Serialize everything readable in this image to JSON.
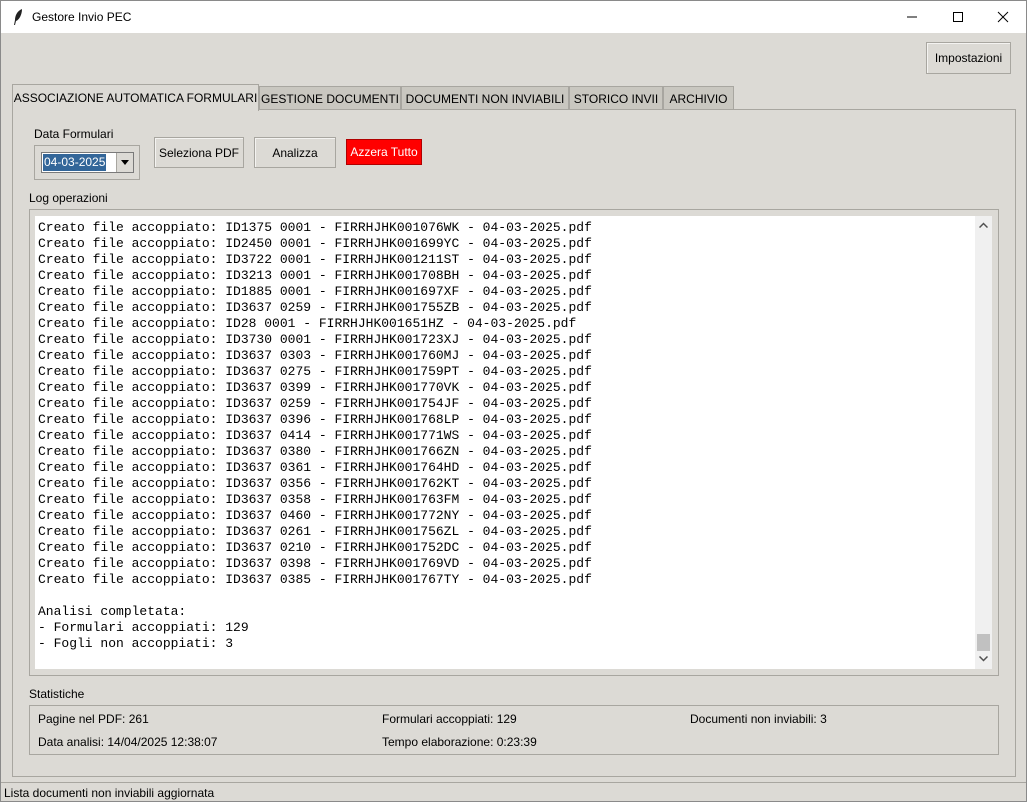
{
  "window": {
    "title": "Gestore Invio PEC",
    "app_icon": "feather-icon"
  },
  "toolbar": {
    "settings_label": "Impostazioni"
  },
  "tabs": [
    {
      "label": "ASSOCIAZIONE AUTOMATICA FORMULARI",
      "active": true
    },
    {
      "label": "GESTIONE DOCUMENTI",
      "active": false
    },
    {
      "label": "DOCUMENTI NON INVIABILI",
      "active": false
    },
    {
      "label": "STORICO INVII",
      "active": false
    },
    {
      "label": "ARCHIVIO",
      "active": false
    }
  ],
  "controls": {
    "date_label": "Data Formulari",
    "date_value": "04-03-2025",
    "select_pdf_label": "Seleziona PDF",
    "analyze_label": "Analizza",
    "reset_label": "Azzera Tutto",
    "reset_color": "#ff0000"
  },
  "log": {
    "label": "Log operazioni",
    "lines": [
      "Creato file accoppiato: ID1375 0001 - FIRRHJHK001076WK - 04-03-2025.pdf",
      "Creato file accoppiato: ID2450 0001 - FIRRHJHK001699YC - 04-03-2025.pdf",
      "Creato file accoppiato: ID3722 0001 - FIRRHJHK001211ST - 04-03-2025.pdf",
      "Creato file accoppiato: ID3213 0001 - FIRRHJHK001708BH - 04-03-2025.pdf",
      "Creato file accoppiato: ID1885 0001 - FIRRHJHK001697XF - 04-03-2025.pdf",
      "Creato file accoppiato: ID3637 0259 - FIRRHJHK001755ZB - 04-03-2025.pdf",
      "Creato file accoppiato: ID28 0001 - FIRRHJHK001651HZ - 04-03-2025.pdf",
      "Creato file accoppiato: ID3730 0001 - FIRRHJHK001723XJ - 04-03-2025.pdf",
      "Creato file accoppiato: ID3637 0303 - FIRRHJHK001760MJ - 04-03-2025.pdf",
      "Creato file accoppiato: ID3637 0275 - FIRRHJHK001759PT - 04-03-2025.pdf",
      "Creato file accoppiato: ID3637 0399 - FIRRHJHK001770VK - 04-03-2025.pdf",
      "Creato file accoppiato: ID3637 0259 - FIRRHJHK001754JF - 04-03-2025.pdf",
      "Creato file accoppiato: ID3637 0396 - FIRRHJHK001768LP - 04-03-2025.pdf",
      "Creato file accoppiato: ID3637 0414 - FIRRHJHK001771WS - 04-03-2025.pdf",
      "Creato file accoppiato: ID3637 0380 - FIRRHJHK001766ZN - 04-03-2025.pdf",
      "Creato file accoppiato: ID3637 0361 - FIRRHJHK001764HD - 04-03-2025.pdf",
      "Creato file accoppiato: ID3637 0356 - FIRRHJHK001762KT - 04-03-2025.pdf",
      "Creato file accoppiato: ID3637 0358 - FIRRHJHK001763FM - 04-03-2025.pdf",
      "Creato file accoppiato: ID3637 0460 - FIRRHJHK001772NY - 04-03-2025.pdf",
      "Creato file accoppiato: ID3637 0261 - FIRRHJHK001756ZL - 04-03-2025.pdf",
      "Creato file accoppiato: ID3637 0210 - FIRRHJHK001752DC - 04-03-2025.pdf",
      "Creato file accoppiato: ID3637 0398 - FIRRHJHK001769VD - 04-03-2025.pdf",
      "Creato file accoppiato: ID3637 0385 - FIRRHJHK001767TY - 04-03-2025.pdf",
      "",
      "Analisi completata:",
      "- Formulari accoppiati: 129",
      "- Fogli non accoppiati: 3"
    ]
  },
  "stats": {
    "label": "Statistiche",
    "pages_in_pdf": "Pagine nel PDF: 261",
    "paired_forms": "Formulari accoppiati: 129",
    "non_sendable": "Documenti non inviabili: 3",
    "analysis_date": "Data analisi: 14/04/2025 12:38:07",
    "processing_time": "Tempo elaborazione: 0:23:39"
  },
  "statusbar": {
    "text": "Lista documenti non inviabili aggiornata"
  }
}
